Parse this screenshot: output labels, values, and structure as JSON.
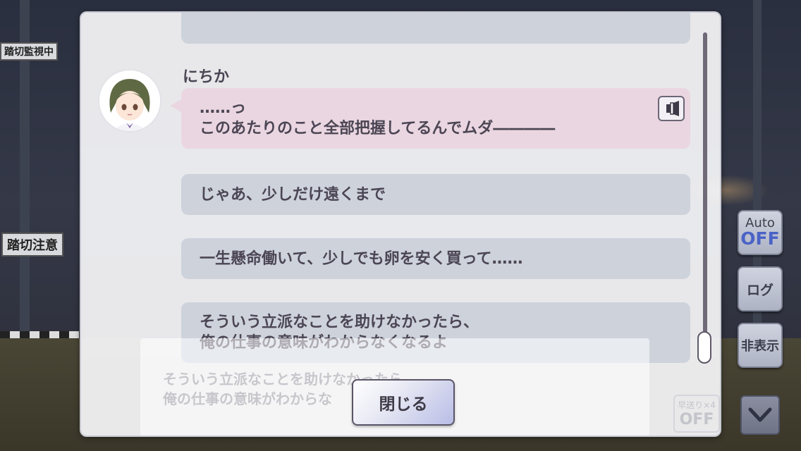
{
  "background": {
    "signs": [
      "踏切監視中",
      "踏切注意"
    ]
  },
  "log": {
    "top_partial_text": "",
    "speaker": "にちか",
    "entries": [
      {
        "lines": [
          "……っ",
          "このあたりのこと全部把握してるんでムダ――――"
        ],
        "style": "pink",
        "has_voice": true
      },
      {
        "lines": [
          "じゃあ、少しだけ遠くまで"
        ],
        "style": "gray"
      },
      {
        "lines": [
          "一生懸命働いて、少しでも卵を安く買って……"
        ],
        "style": "gray"
      },
      {
        "lines": [
          "そういう立派なことを助けなかったら、",
          "俺の仕事の意味がわからなくなるよ"
        ],
        "style": "gray"
      }
    ],
    "close_label": "閉じる"
  },
  "ghost_dialog": {
    "lines": [
      "そういう立派なことを助けなかったら",
      "俺の仕事の意味がわからな"
    ],
    "badge_top": "早送り×4",
    "badge_bottom": "OFF"
  },
  "side_buttons": {
    "auto_top": "Auto",
    "auto_state": "OFF",
    "log": "ログ",
    "hide": "非表示",
    "skip_icon": "chevron-down-icon"
  },
  "colors": {
    "pink_bubble": "#ead6e1",
    "gray_bubble": "#cdd2db",
    "auto_off": "#4b63c6"
  }
}
